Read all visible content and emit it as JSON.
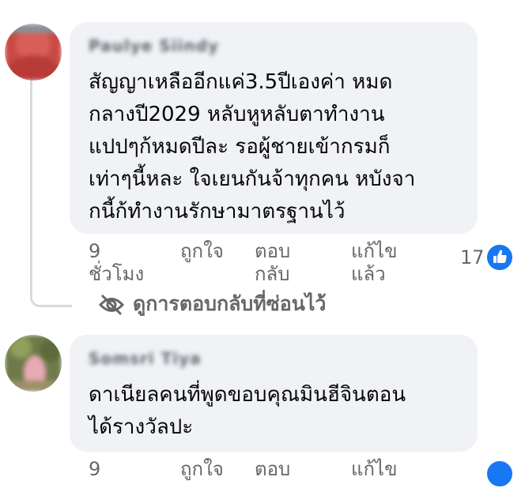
{
  "comments": [
    {
      "author": "Paulye Siindy",
      "lines": [
        "สัญญาเหลืออีกแค่3.5ปีเองค่า หมด",
        "กลางปี2029 หลับหูหลับตาทำงาน",
        "แปปๆก้หมดปีละ รอผู้ชายเข้ากรมก็",
        "เท่าๆนี้หละ ใจเยนกันจ้าทุกคน หบังจา",
        "กนี้ก้ทำงานรักษามาตรฐานไว้"
      ],
      "time_value": "9",
      "time_unit": "ชั่วโมง",
      "like_label": "ถูกใจ",
      "reply_line1": "ตอบ",
      "reply_line2": "กลับ",
      "edit_line1": "แก้ไข",
      "edit_line2": "แล้ว",
      "reaction_count": "17",
      "hidden_replies_label": "ดูการตอบกลับที่ซ่อนไว้"
    },
    {
      "author": "Somsri Tiya",
      "lines": [
        "ดาเนียลคนที่พูดขอบคุณมินฮีจินตอน",
        "ได้รางวัลปะ"
      ],
      "time_value": "9",
      "like_label": "ถูกใจ",
      "reply_line1": "ตอบ",
      "edit_line1": "แก้ไข"
    }
  ],
  "colors": {
    "bubble": "#f0f2f5",
    "secondary_text": "#65676b",
    "like_blue": "#1877f2"
  },
  "icons": {
    "hidden": "eye-slash-icon",
    "like": "thumbs-up-icon"
  }
}
